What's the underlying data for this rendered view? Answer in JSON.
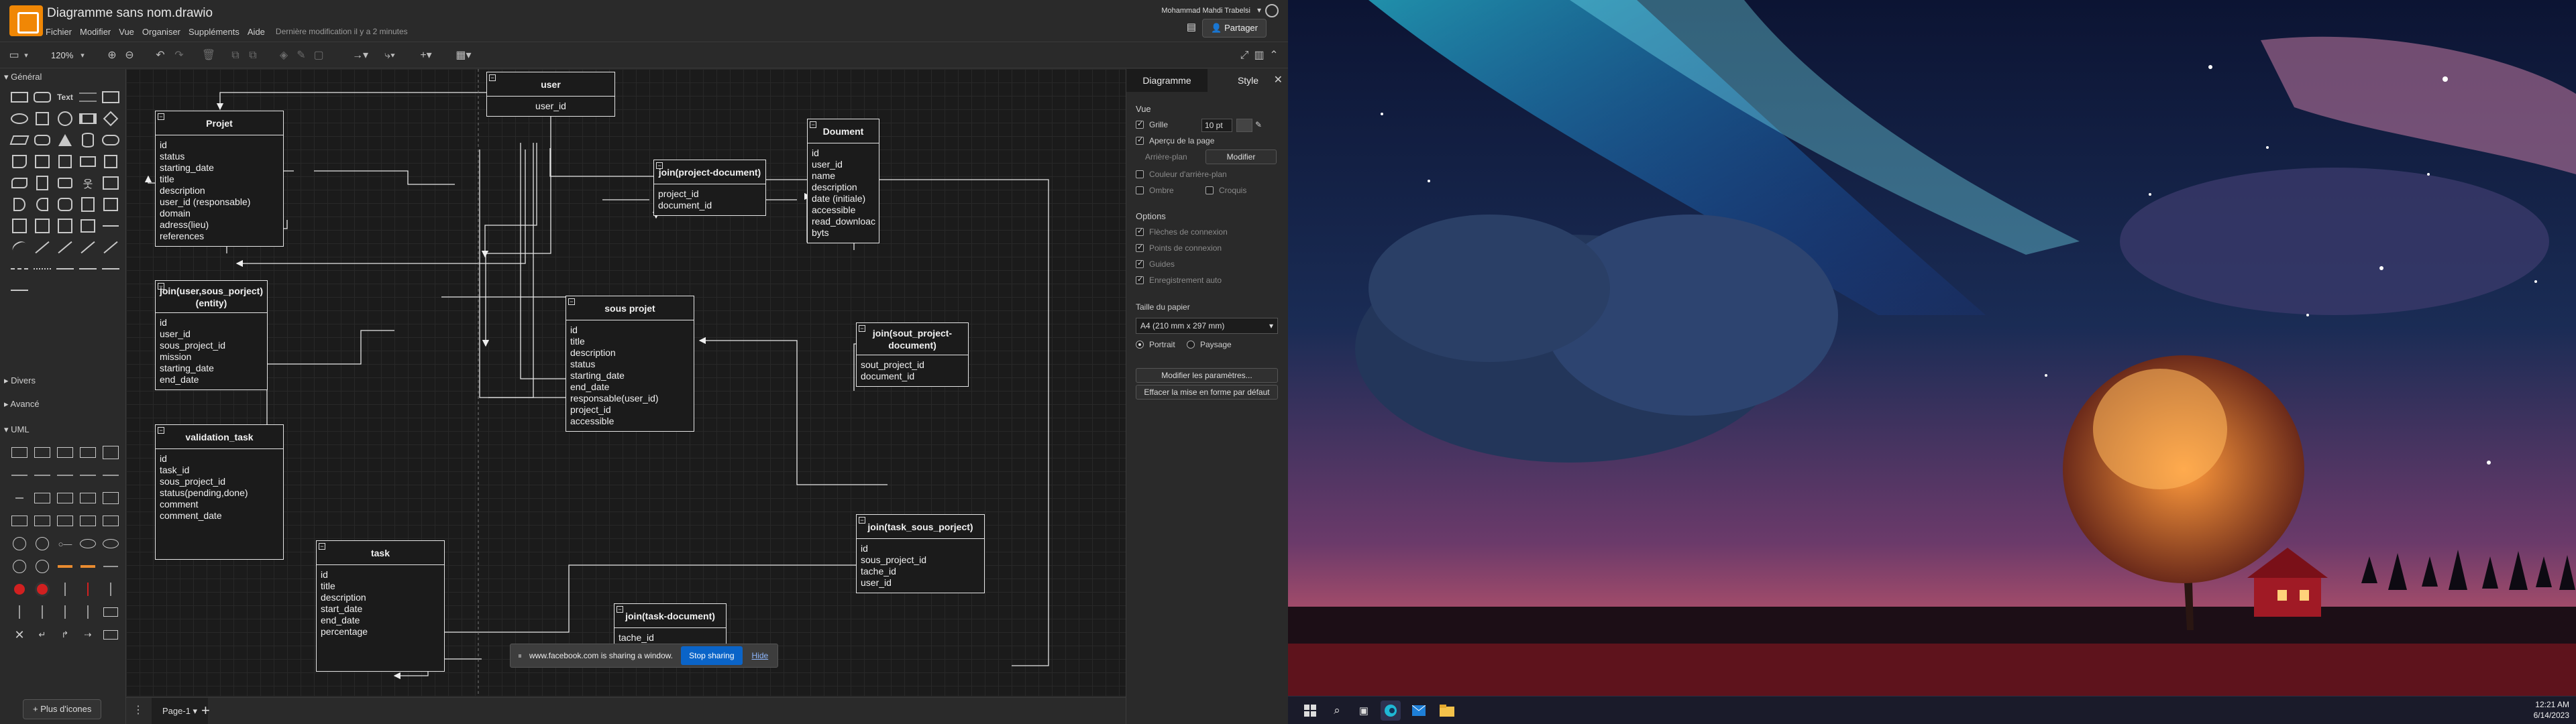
{
  "app": {
    "title": "Diagramme sans nom.drawio",
    "menu": [
      "Fichier",
      "Modifier",
      "Vue",
      "Organiser",
      "Suppléments",
      "Aide"
    ],
    "last_modified": "Dernière modification il y a 2 minutes",
    "user_name": "Mohammad Mahdi Trabelsi",
    "share_label": "Partager",
    "zoom": "120%"
  },
  "sidebar": {
    "general": "Général",
    "divers": "Divers",
    "avance": "Avancé",
    "uml": "UML",
    "more_shapes": "+ Plus d'icones"
  },
  "page_tab": "Page-1",
  "format_panel": {
    "tab_diagram": "Diagramme",
    "tab_style": "Style",
    "vue_title": "Vue",
    "grid_label": "Grille",
    "grid_size": "10 pt",
    "page_preview": "Aperçu de la page",
    "background_label": "Arrière-plan",
    "modify_btn": "Modifier",
    "background_color": "Couleur d'arrière-plan",
    "shadow": "Ombre",
    "sketch": "Croquis",
    "options_title": "Options",
    "connection_arrows": "Flèches de connexion",
    "connection_points": "Points de connexion",
    "guides": "Guides",
    "autosave": "Enregistrement auto",
    "paper_title": "Taille du papier",
    "paper_size": "A4 (210 mm x 297 mm)",
    "portrait": "Portrait",
    "landscape": "Paysage",
    "edit_params_btn": "Modifier les paramètres...",
    "reset_style_btn": "Effacer la mise en forme par défaut"
  },
  "diagram": {
    "tables": [
      {
        "id": "user",
        "title": "user",
        "fields": [
          "user_id"
        ]
      },
      {
        "id": "projet",
        "title": "Projet",
        "fields": [
          "id",
          "status",
          "starting_date",
          "title",
          "description",
          "user_id (responsable)",
          "domain",
          "adress(lieu)",
          "references"
        ]
      },
      {
        "id": "join-project-document",
        "title": "join(project-document)",
        "fields": [
          "project_id",
          "document_id"
        ]
      },
      {
        "id": "doument",
        "title": "Doument",
        "fields": [
          "id",
          "user_id",
          "name",
          "description",
          "date (initiale)",
          "accessible",
          "read_downloac",
          "byts"
        ]
      },
      {
        "id": "join-user-sous-project",
        "title": "join(user,sous_porject)",
        "subtitle": "(entity)",
        "fields": [
          "id",
          "user_id",
          "sous_project_id",
          "mission",
          "starting_date",
          "end_date"
        ]
      },
      {
        "id": "sous-projet",
        "title": "sous projet",
        "fields": [
          "id",
          "title",
          "description",
          "status",
          "starting_date",
          "end_date",
          "responsable(user_id)",
          "project_id",
          "accessible"
        ]
      },
      {
        "id": "join-sout-project-document",
        "title": "join(sout_project-",
        "subtitle": "document)",
        "fields": [
          "sout_project_id",
          "document_id"
        ]
      },
      {
        "id": "validation-task",
        "title": "validation_task",
        "fields": [
          "id",
          "task_id",
          "sous_project_id",
          "status(pending,done)",
          "comment",
          "comment_date"
        ]
      },
      {
        "id": "join-task-sous-porject",
        "title": "join(task_sous_porject)",
        "fields": [
          "id",
          "sous_project_id",
          "tache_id",
          "user_id"
        ]
      },
      {
        "id": "task",
        "title": "task",
        "fields": [
          "id",
          "title",
          "description",
          "start_date",
          "end_date",
          "percentage"
        ]
      },
      {
        "id": "join-task-document",
        "title": "join(task-document)",
        "fields": [
          "tache_id"
        ]
      }
    ]
  },
  "share_banner": {
    "text": "www.facebook.com is sharing a window.",
    "stop": "Stop sharing",
    "hide": "Hide"
  },
  "taskbar": {
    "time": "12:21 AM",
    "date": "6/14/2023"
  }
}
